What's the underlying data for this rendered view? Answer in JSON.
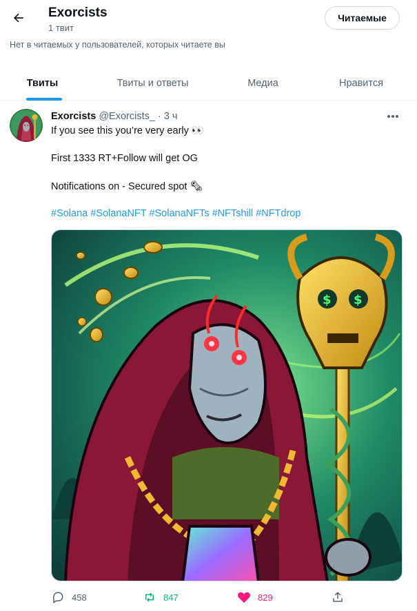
{
  "header": {
    "title": "Exorcists",
    "tweet_count": "1 твит",
    "following_button": "Читаемые",
    "followers_note": "Нет в читаемых у пользователей, которых читаете вы"
  },
  "tabs": [
    {
      "label": "Твиты",
      "active": true
    },
    {
      "label": "Твиты и ответы",
      "active": false
    },
    {
      "label": "Медиа",
      "active": false
    },
    {
      "label": "Нравится",
      "active": false
    }
  ],
  "tweet": {
    "author_name": "Exorcists",
    "author_handle": "@Exorcists_",
    "separator": "·",
    "time": "3 ч",
    "lines": [
      "If you see this you’re very early 👀",
      "First 1333 RT+Follow will get OG",
      "Notifications on - Secured spot 🗞"
    ],
    "hashtags": [
      "#Solana",
      "#SolanaNFT",
      "#SolanaNFTs",
      "#NFTshill",
      "#NFTdrop"
    ],
    "stats": {
      "replies": "458",
      "retweets": "847",
      "likes": "829"
    }
  },
  "colors": {
    "accent": "#1d9bf0",
    "retweet": "#00ba7c",
    "like": "#f91880",
    "secondary_text": "#536471"
  },
  "icons": {
    "back": "arrow-left-icon",
    "more": "more-dots-icon",
    "reply": "reply-bubble-icon",
    "retweet": "retweet-icon",
    "like": "heart-icon",
    "share": "share-icon"
  }
}
